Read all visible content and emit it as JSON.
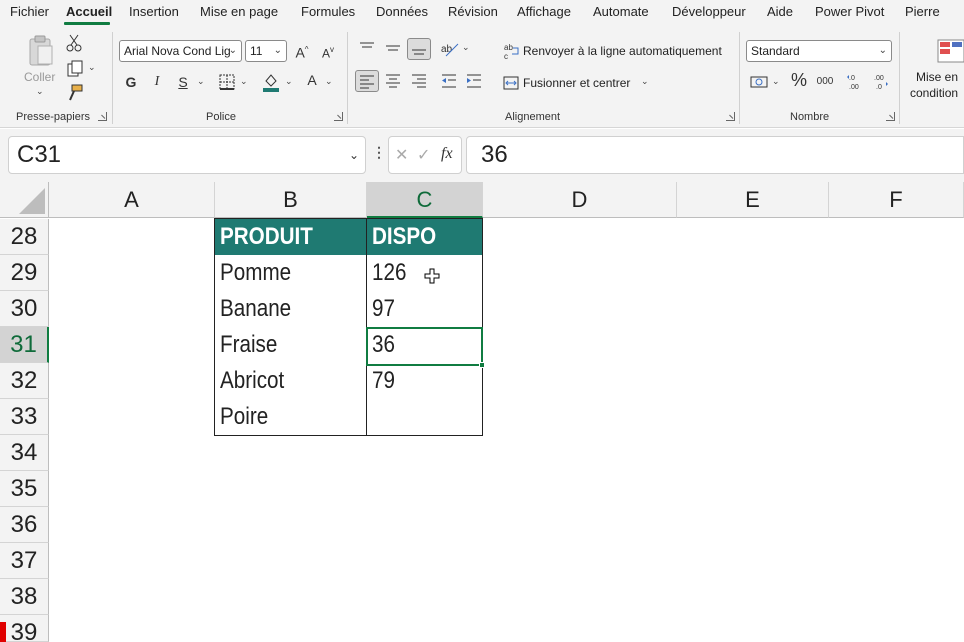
{
  "menu": {
    "items": [
      "Fichier",
      "Accueil",
      "Insertion",
      "Mise en page",
      "Formules",
      "Données",
      "Révision",
      "Affichage",
      "Automate",
      "Développeur",
      "Aide",
      "Power Pivot",
      "Pierre"
    ],
    "active_index": 1
  },
  "ribbon": {
    "clipboard": {
      "label": "Presse-papiers",
      "paste_label": "Coller"
    },
    "font": {
      "label": "Police",
      "font_name": "Arial Nova Cond Lig",
      "font_size": "11",
      "bold": "G",
      "italic": "I",
      "underline": "S",
      "grow": "A",
      "shrink": "A",
      "font_color_letter": "A"
    },
    "alignment": {
      "label": "Alignement",
      "wrap_label": "Renvoyer à la ligne automatiquement",
      "merge_label": "Fusionner et centrer"
    },
    "number": {
      "label": "Nombre",
      "format": "Standard",
      "percent": "%",
      "thousands": "000"
    },
    "cond_format": {
      "line1": "Mise en",
      "line2": "condition"
    }
  },
  "formula_bar": {
    "name_box": "C31",
    "dots": "⋮",
    "cancel": "✕",
    "enter": "✓",
    "fx": "fx",
    "formula": "36"
  },
  "grid": {
    "columns": [
      "A",
      "B",
      "C",
      "D",
      "E",
      "F"
    ],
    "active_column": "C",
    "rows": [
      "28",
      "29",
      "30",
      "31",
      "32",
      "33",
      "34",
      "35",
      "36",
      "37",
      "38",
      "39"
    ],
    "active_row": "31"
  },
  "table": {
    "headers": [
      "PRODUIT",
      "DISPO"
    ],
    "rows": [
      [
        "Pomme",
        "126"
      ],
      [
        "Banane",
        "97"
      ],
      [
        "Fraise",
        "36"
      ],
      [
        "Abricot",
        "79"
      ],
      [
        "Poire",
        ""
      ]
    ],
    "header_color": "#1f7a72"
  },
  "colors": {
    "accent": "#107c41",
    "ribbon_bg": "#f3f3f3"
  }
}
